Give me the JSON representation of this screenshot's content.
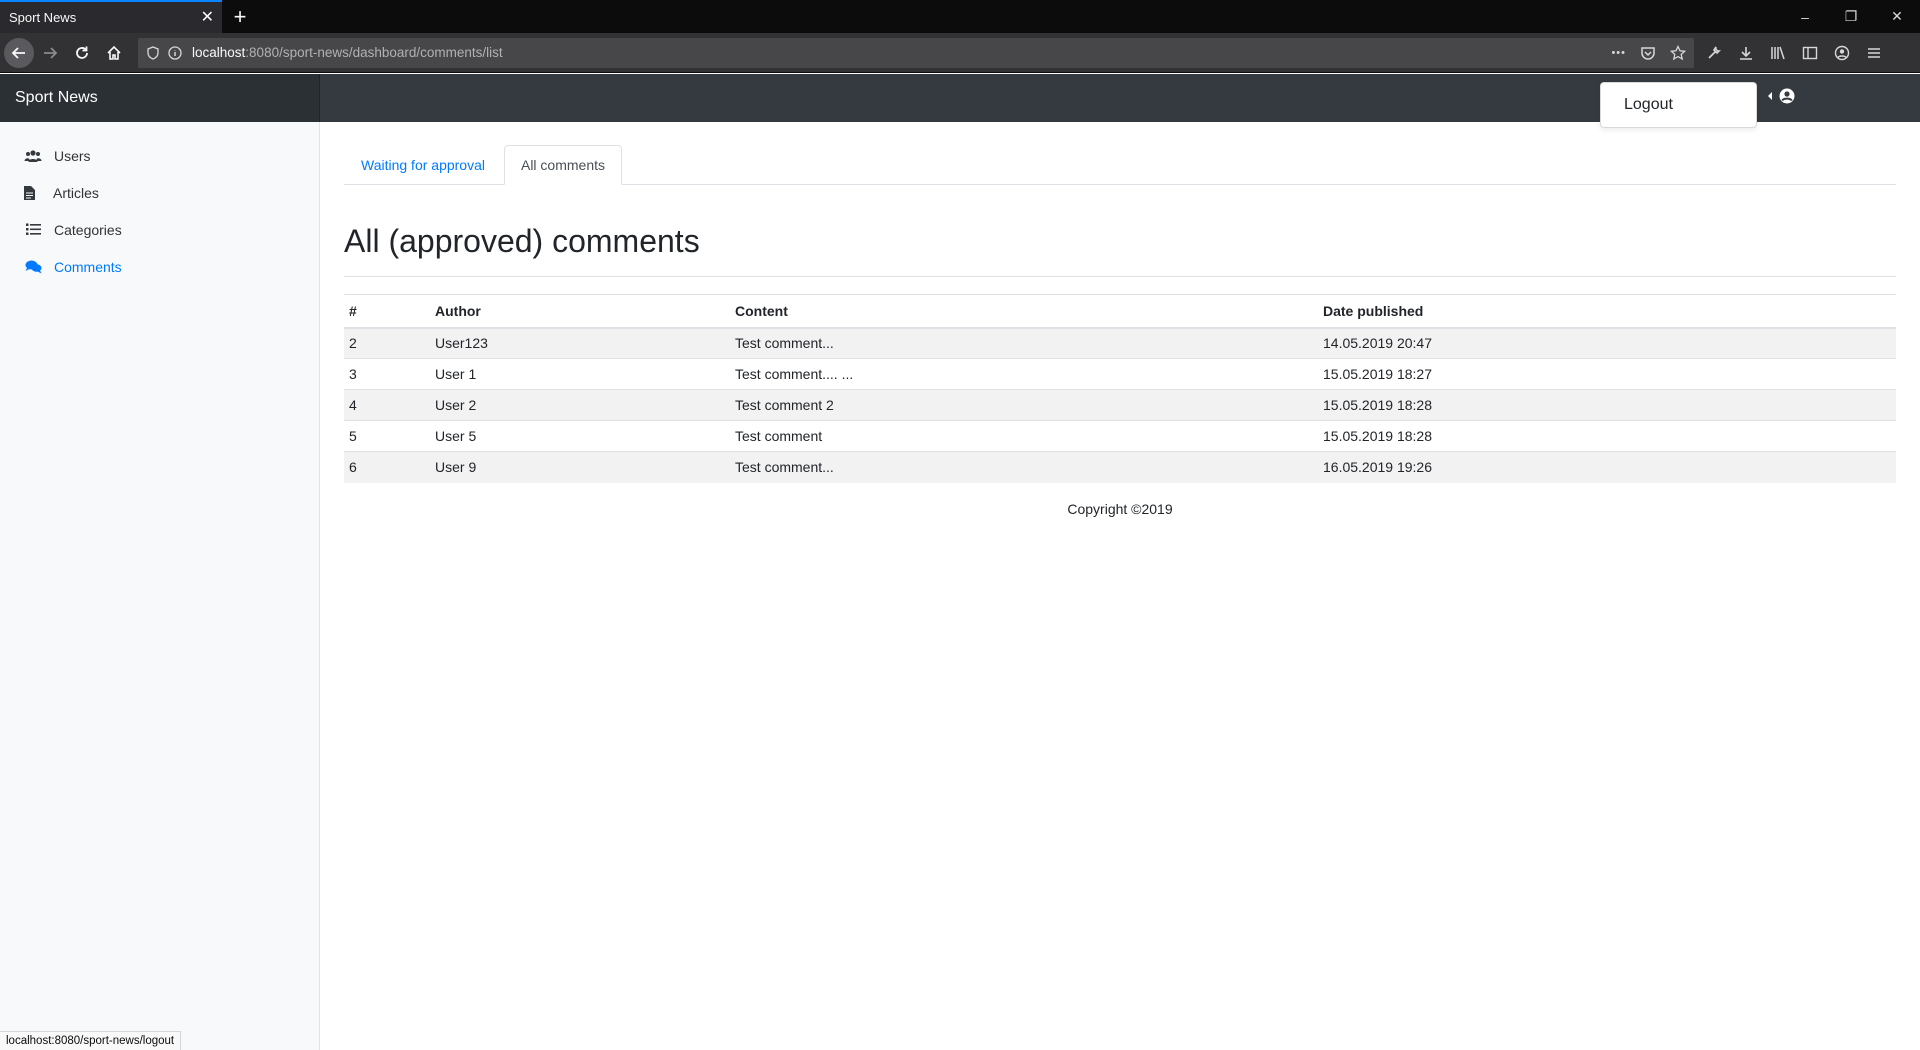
{
  "browser": {
    "tab_title": "Sport News",
    "tab_close": "✕",
    "new_tab": "+",
    "url_host": "localhost",
    "url_path": ":8080/sport-news/dashboard/comments/list",
    "status_url": "localhost:8080/sport-news/logout",
    "window_controls": [
      "–",
      "❐",
      "✕"
    ],
    "more_dots": "•••"
  },
  "header": {
    "brand": "Sport News",
    "user_menu": {
      "items": [
        "Logout"
      ]
    }
  },
  "sidebar": {
    "items": [
      {
        "label": "Users",
        "icon": "users-icon",
        "active": false
      },
      {
        "label": "Articles",
        "icon": "file-icon",
        "active": false
      },
      {
        "label": "Categories",
        "icon": "list-icon",
        "active": false
      },
      {
        "label": "Comments",
        "icon": "comments-icon",
        "active": true
      }
    ]
  },
  "main": {
    "tabs": [
      {
        "label": "Waiting for approval",
        "active": false
      },
      {
        "label": "All comments",
        "active": true
      }
    ],
    "title": "All (approved) comments",
    "table": {
      "columns": [
        "#",
        "Author",
        "Content",
        "Date published"
      ],
      "rows": [
        [
          "2",
          "User123",
          "Test comment...",
          "14.05.2019 20:47"
        ],
        [
          "3",
          "User 1",
          "Test comment.... ...",
          "15.05.2019 18:27"
        ],
        [
          "4",
          "User 2",
          "Test comment 2",
          "15.05.2019 18:28"
        ],
        [
          "5",
          "User 5",
          "Test comment",
          "15.05.2019 18:28"
        ],
        [
          "6",
          "User 9",
          "Test comment...",
          "16.05.2019 19:26"
        ]
      ]
    },
    "footer": "Copyright ©2019"
  },
  "colors": {
    "accent": "#007bff",
    "header_bg": "#343a40",
    "brand_bg": "#2b3035",
    "browser_tab_accent": "#0a84ff"
  }
}
